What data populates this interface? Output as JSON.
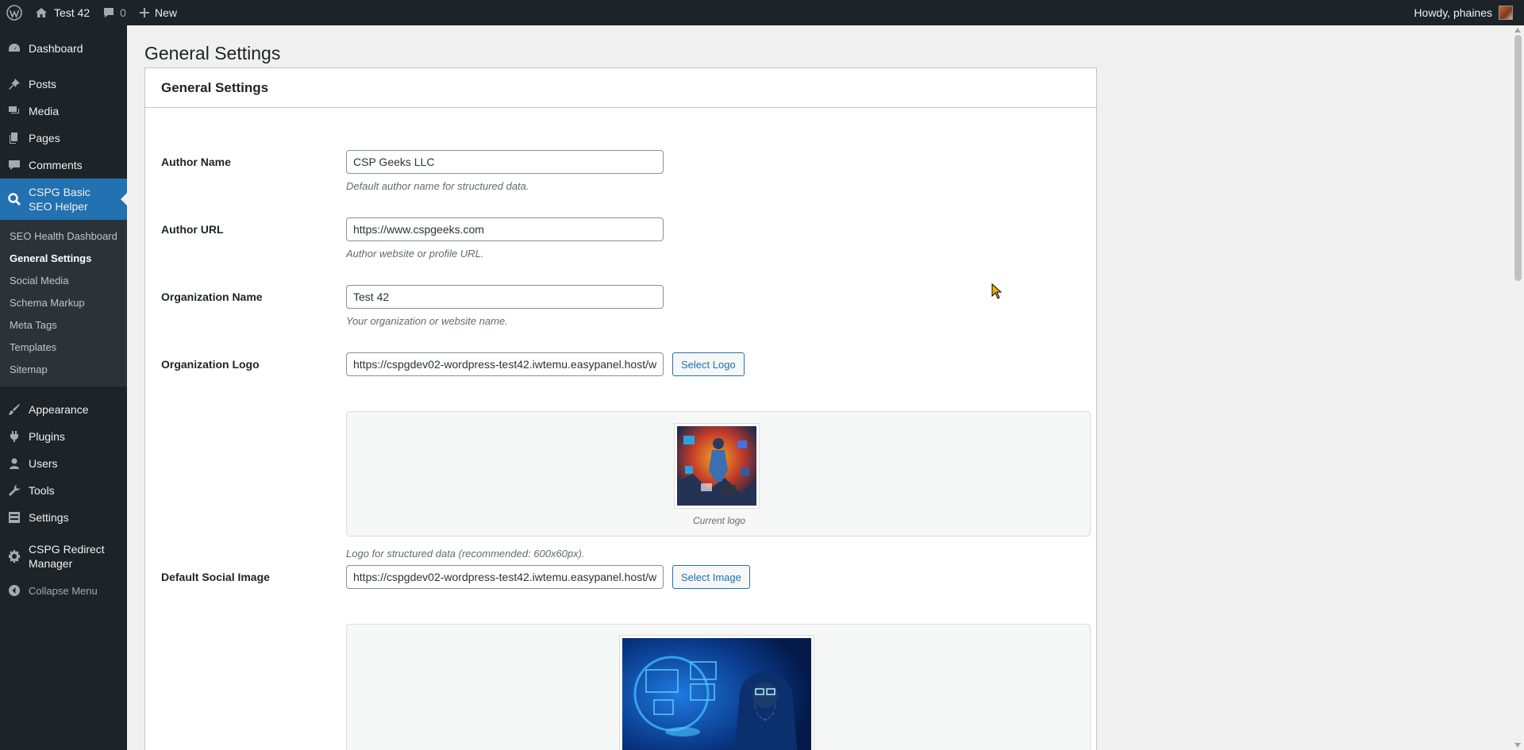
{
  "adminbar": {
    "site_name": "Test 42",
    "comments_count": "0",
    "new_label": "New",
    "howdy": "Howdy, phaines"
  },
  "sidebar": {
    "items": [
      {
        "label": "Dashboard",
        "icon": "dashboard-icon"
      },
      {
        "label": "Posts",
        "icon": "pin-icon"
      },
      {
        "label": "Media",
        "icon": "media-icon"
      },
      {
        "label": "Pages",
        "icon": "pages-icon"
      },
      {
        "label": "Comments",
        "icon": "comment-icon"
      },
      {
        "label": "CSPG Basic SEO Helper",
        "icon": "search-icon"
      },
      {
        "label": "Appearance",
        "icon": "brush-icon"
      },
      {
        "label": "Plugins",
        "icon": "plug-icon"
      },
      {
        "label": "Users",
        "icon": "user-icon"
      },
      {
        "label": "Tools",
        "icon": "wrench-icon"
      },
      {
        "label": "Settings",
        "icon": "settings-sliders-icon"
      },
      {
        "label": "CSPG Redirect Manager",
        "icon": "gear-icon"
      }
    ],
    "submenu": [
      "SEO Health Dashboard",
      "General Settings",
      "Social Media",
      "Schema Markup",
      "Meta Tags",
      "Templates",
      "Sitemap"
    ],
    "collapse_label": "Collapse Menu"
  },
  "main": {
    "page_title": "General Settings",
    "tab_label": "General Settings",
    "author_name": {
      "label": "Author Name",
      "value": "CSP Geeks LLC",
      "desc": "Default author name for structured data."
    },
    "author_url": {
      "label": "Author URL",
      "value": "https://www.cspgeeks.com",
      "desc": "Author website or profile URL."
    },
    "org_name": {
      "label": "Organization Name",
      "value": "Test 42",
      "desc": "Your organization or website name."
    },
    "org_logo": {
      "label": "Organization Logo",
      "value": "https://cspgdev02-wordpress-test42.iwtemu.easypanel.host/w",
      "button": "Select Logo",
      "caption": "Current logo",
      "desc": "Logo for structured data (recommended: 600x60px)."
    },
    "social_image": {
      "label": "Default Social Image",
      "value": "https://cspgdev02-wordpress-test42.iwtemu.easypanel.host/w",
      "button": "Select Image"
    }
  },
  "colors": {
    "accent": "#2271b1",
    "sidebar_bg": "#1d2327",
    "submenu_bg": "#2c3338",
    "page_bg": "#f0f0f1"
  }
}
